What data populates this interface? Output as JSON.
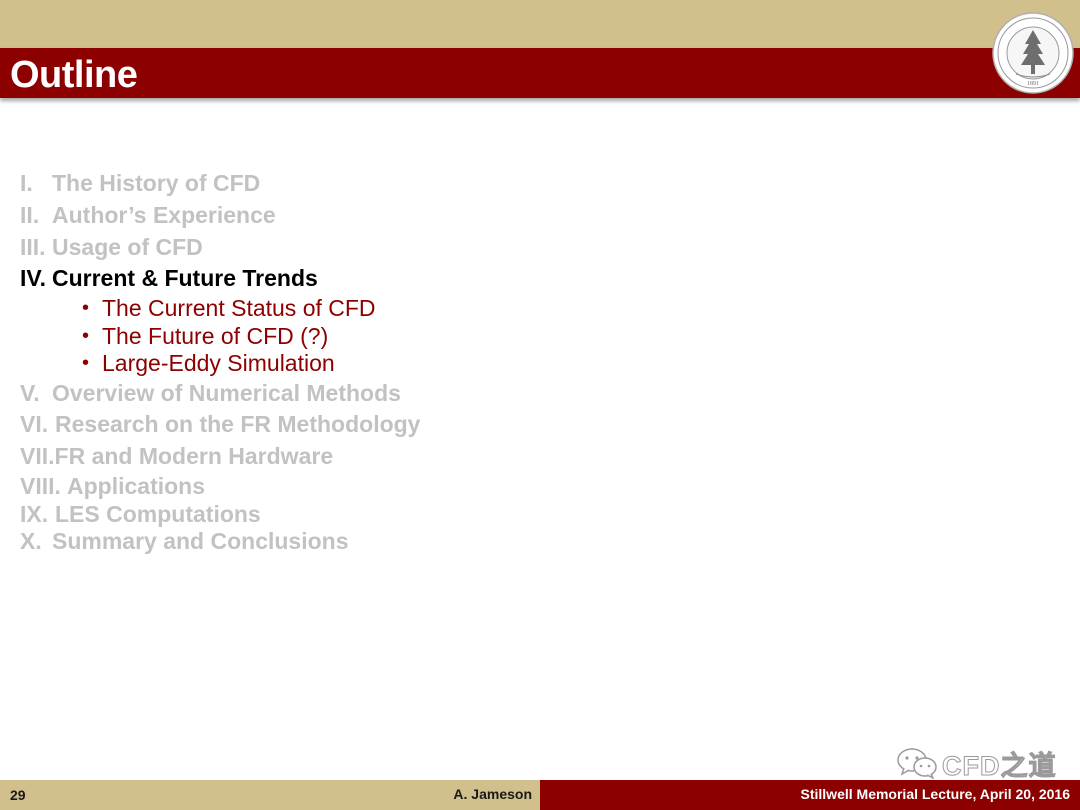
{
  "slide": {
    "title": "Outline",
    "seal_year": "1891"
  },
  "outline": {
    "items": [
      {
        "num": "I.",
        "label": "The History of CFD",
        "state": "inactive"
      },
      {
        "num": "II.",
        "label": "Author’s Experience",
        "state": "inactive"
      },
      {
        "num": "III.",
        "label": "Usage of CFD",
        "state": "inactive"
      },
      {
        "num": "IV.",
        "label": "Current & Future Trends",
        "state": "active"
      },
      {
        "num": "V.",
        "label": "Overview of Numerical Methods",
        "state": "inactive"
      },
      {
        "num": "VI.",
        "label": "Research on the FR Methodology",
        "state": "inactive"
      },
      {
        "num": "VII.",
        "label": "FR and Modern Hardware",
        "state": "inactive"
      },
      {
        "num": "VIII.",
        "label": "Applications",
        "state": "inactive"
      },
      {
        "num": "IX.",
        "label": "LES Computations",
        "state": "inactive"
      },
      {
        "num": "X.",
        "label": "Summary and Conclusions",
        "state": "inactive"
      }
    ],
    "subitems": [
      "The Current Status of CFD",
      "The Future of CFD (?)",
      "Large-Eddy Simulation"
    ],
    "bullet": "•"
  },
  "watermark": {
    "text": "CFD之道",
    "icon": "wechat-icon"
  },
  "footer": {
    "page_number": "29",
    "author": "A. Jameson",
    "event": "Stillwell Memorial Lecture, April 20, 2016"
  },
  "colors": {
    "cardinal": "#8c0000",
    "tan": "#d1bf8c",
    "inactive_text": "#c2c2c2",
    "active_text": "#000000"
  }
}
